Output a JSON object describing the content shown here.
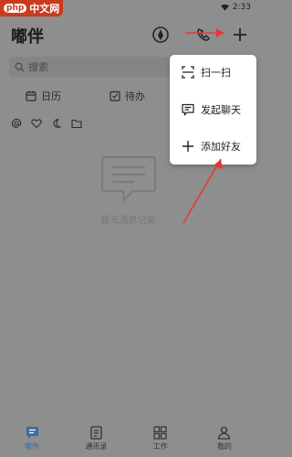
{
  "watermark": {
    "badge": "php",
    "text": "中文网"
  },
  "status": {
    "time": "2:33"
  },
  "header": {
    "title": "嘟伴"
  },
  "search": {
    "placeholder": "搜索"
  },
  "quick": {
    "calendar": "日历",
    "todo": "待办"
  },
  "empty": {
    "label": "暂无消息记录"
  },
  "popup": {
    "items": [
      {
        "label": "扫一扫",
        "icon": "scan-icon"
      },
      {
        "label": "发起聊天",
        "icon": "chat-icon"
      },
      {
        "label": "添加好友",
        "icon": "plus-icon"
      }
    ]
  },
  "tabs": [
    {
      "label": "嘟件",
      "icon": "message-icon",
      "active": true
    },
    {
      "label": "通讯录",
      "icon": "contacts-icon",
      "active": false
    },
    {
      "label": "工作",
      "icon": "grid-icon",
      "active": false
    },
    {
      "label": "我的",
      "icon": "user-icon",
      "active": false
    }
  ],
  "colors": {
    "overlay": "#8e8e8e",
    "accent": "#3a6aa8",
    "arrow": "#e53935"
  }
}
